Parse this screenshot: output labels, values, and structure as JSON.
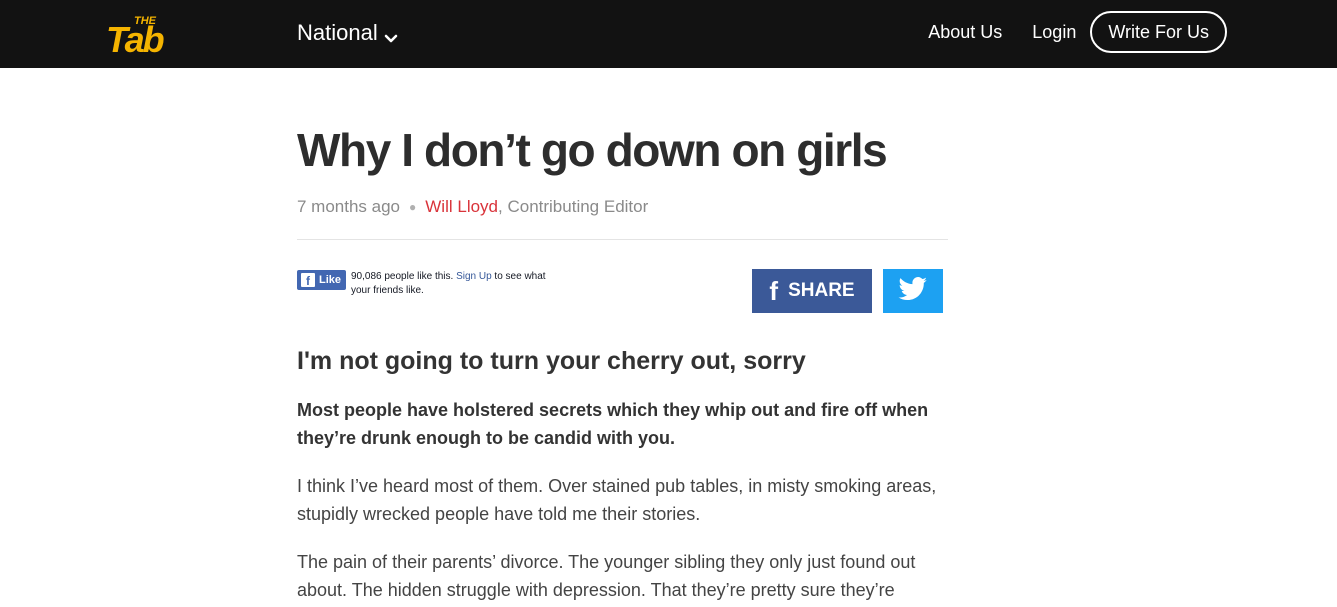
{
  "header": {
    "logo_text_top": "THE",
    "logo_text_main": "Tab",
    "edition": "National",
    "links": [
      "About Us",
      "Login"
    ],
    "cta": "Write For Us"
  },
  "article": {
    "title": "Why I don’t go down on girls",
    "time_ago": "7 months ago",
    "author": "Will Lloyd",
    "author_role": ", Contributing Editor",
    "fb_like_label": "Like",
    "fb_like_count_text": "90,086 people like this.",
    "fb_signup": "Sign Up",
    "fb_after_signup": " to see what your friends like.",
    "share_label": "SHARE",
    "subtitle": "I'm not going to turn your cherry out, sorry",
    "lead": "Most people have holstered secrets which they whip out and fire off when they’re drunk enough to be candid with you.",
    "paragraphs": [
      "I think I’ve heard most of them. Over stained pub tables, in misty smoking areas, stupidly wrecked people have told me their stories.",
      "The pain of their parents’ divorce. The younger sibling they only just found out about. The hidden struggle with depression. That they’re pretty sure they’re"
    ]
  },
  "colors": {
    "topbar": "#121212",
    "logo": "#f5b400",
    "author": "#d9333a",
    "facebook": "#3b5998",
    "twitter": "#1da1f2"
  },
  "icons": [
    "chevron-down-icon",
    "facebook-icon",
    "twitter-icon"
  ]
}
